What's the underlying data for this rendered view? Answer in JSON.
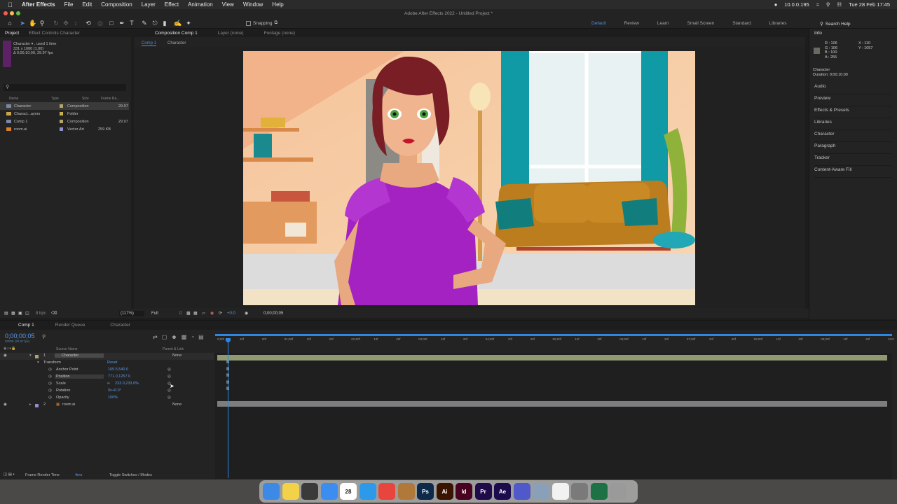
{
  "menubar": {
    "app": "After Effects",
    "items": [
      "File",
      "Edit",
      "Composition",
      "Layer",
      "Effect",
      "Animation",
      "View",
      "Window",
      "Help"
    ],
    "ip": "10.0.0.195",
    "datetime": "Tue 28 Feb  17:45"
  },
  "window": {
    "title": "Adobe After Effects 2022 - Untitled Project *"
  },
  "toolbar": {
    "snapping": "Snapping",
    "workspaces": [
      "Default",
      "Review",
      "Learn",
      "Small Screen",
      "Standard",
      "Libraries"
    ],
    "active_workspace": "Default",
    "search_help": "Search Help"
  },
  "project_panel": {
    "tabs": [
      "Project",
      "Effect Controls Character"
    ],
    "selected_name": "Character ▾ , used 1 time",
    "selected_dims": "331 x 1080 (1.00)",
    "selected_dur": "Δ 0;00;10;00, 29.97 fps",
    "columns": [
      "Name",
      "Type",
      "Size",
      "Frame Ra..."
    ],
    "items": [
      {
        "name": "Character",
        "type": "Composition",
        "size": "",
        "fps": "29.97",
        "label_color": "#b6a56a"
      },
      {
        "name": "Charact...ayers",
        "type": "Folder",
        "size": "",
        "fps": "",
        "label_color": "#c8b14a"
      },
      {
        "name": "Comp 1",
        "type": "Composition",
        "size": "",
        "fps": "29.97",
        "label_color": "#b6a56a"
      },
      {
        "name": "room.ai",
        "type": "Vector Art",
        "size": "259 KB",
        "fps": "",
        "label_color": "#8f8fd0"
      }
    ]
  },
  "composition_panel": {
    "tabs": [
      "Composition Comp 1",
      "Layer (none)",
      "Footage (none)"
    ],
    "breadcrumbs": [
      "Comp 1",
      "Character"
    ],
    "bpc": "8 bpc",
    "zoom": "(117%)",
    "resolution": "Full",
    "exposure": "+0.0",
    "timecode": "0;00;00;05"
  },
  "info_panel": {
    "title": "Info",
    "r": "R : 106",
    "g": "G : 106",
    "b": "B : 100",
    "a": "A : 255",
    "x": "X : 110",
    "y": "Y : 1057",
    "layer": "Character",
    "duration": "Duration: 0;00;10;00",
    "panels": [
      "Audio",
      "Preview",
      "Effects & Presets",
      "Libraries",
      "Character",
      "Paragraph",
      "Tracker",
      "Content-Aware Fill"
    ]
  },
  "timeline": {
    "tabs": [
      "Comp 1",
      "Render Queue",
      "Character"
    ],
    "timecode": "0;00;00;05",
    "timecode_sub": "00005 (29.97 fps)",
    "col_source": "Source Name",
    "col_parent": "Parent & Link",
    "layer1": {
      "num": "1",
      "name": "Character",
      "parent": "None"
    },
    "transform": "Transform",
    "reset": "Reset",
    "props": [
      {
        "name": "Anchor Point",
        "value": "165.5,540.0"
      },
      {
        "name": "Position",
        "value": "771.0,1257.0"
      },
      {
        "name": "Scale",
        "value": "233.0,233.0%"
      },
      {
        "name": "Rotation",
        "value": "0x+0.0°"
      },
      {
        "name": "Opacity",
        "value": "100%"
      }
    ],
    "layer2": {
      "num": "2",
      "name": "room.ai",
      "parent": "None"
    },
    "ruler": [
      "0;00f",
      "10f",
      "20f",
      "01;00f",
      "10f",
      "20f",
      "02;00f",
      "10f",
      "20f",
      "03;00f",
      "10f",
      "20f",
      "04;00f",
      "10f",
      "20f",
      "05;00f",
      "10f",
      "20f",
      "06;00f",
      "10f",
      "20f",
      "07;00f",
      "10f",
      "20f",
      "08;00f",
      "10f",
      "20f",
      "09;00f",
      "10f",
      "20f",
      "10;0"
    ],
    "frame_render": "Frame Render Time",
    "frame_render_val": "4ms",
    "toggle": "Toggle Switches / Modes"
  },
  "dock": {
    "apps": [
      {
        "name": "Finder",
        "label": "",
        "color": "#3d8ae6"
      },
      {
        "name": "Notes",
        "label": "",
        "color": "#f3d24a"
      },
      {
        "name": "Calculator",
        "label": "",
        "color": "#3a3a3a"
      },
      {
        "name": "Mail",
        "label": "",
        "color": "#3b8ef0"
      },
      {
        "name": "Calendar",
        "label": "28",
        "color": "#ffffff"
      },
      {
        "name": "Safari",
        "label": "",
        "color": "#2c9ae8"
      },
      {
        "name": "Chrome",
        "label": "",
        "color": "#e8453c"
      },
      {
        "name": "Blender",
        "label": "",
        "color": "#b0793a"
      },
      {
        "name": "Photoshop",
        "label": "Ps",
        "color": "#0d2a4a"
      },
      {
        "name": "Illustrator",
        "label": "Ai",
        "color": "#3a1400"
      },
      {
        "name": "InDesign",
        "label": "Id",
        "color": "#49021f"
      },
      {
        "name": "Premiere Pro",
        "label": "Pr",
        "color": "#1f0a4a"
      },
      {
        "name": "After Effects",
        "label": "Ae",
        "color": "#1c0b4d"
      },
      {
        "name": "Teams",
        "label": "",
        "color": "#5059c9"
      },
      {
        "name": "Preview",
        "label": "",
        "color": "#8aa0b8"
      },
      {
        "name": "TextEdit",
        "label": "",
        "color": "#f2f2f2"
      },
      {
        "name": "System Preferences",
        "label": "",
        "color": "#7a7a7a"
      },
      {
        "name": "Excel",
        "label": "",
        "color": "#1e7145"
      },
      {
        "name": "Trash",
        "label": "",
        "color": "#9a9a9a"
      }
    ]
  }
}
